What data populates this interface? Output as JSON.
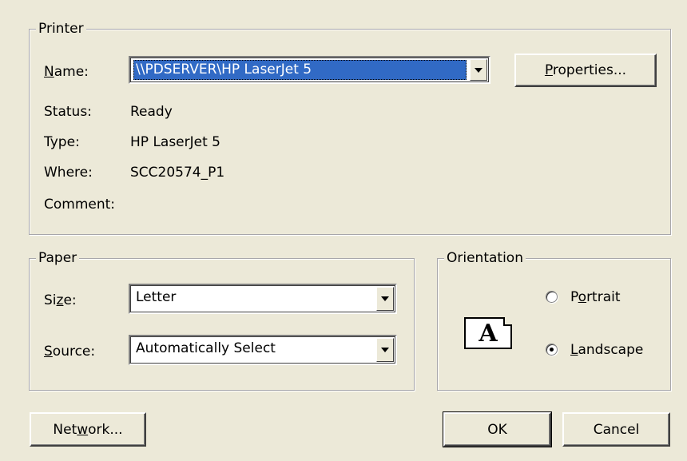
{
  "printer": {
    "title": "Printer",
    "name_label_accel": "N",
    "name_label_rest": "ame:",
    "name_value": "\\\\PDSERVER\\HP LaserJet 5",
    "properties_accel": "P",
    "properties_rest": "roperties...",
    "status_label": "Status:",
    "status_value": "Ready",
    "type_label": "Type:",
    "type_value": "HP LaserJet 5",
    "where_label": "Where:",
    "where_value": "SCC20574_P1",
    "comment_label": "Comment:",
    "comment_value": ""
  },
  "paper": {
    "title": "Paper",
    "size_label_pre": "Si",
    "size_label_accel": "z",
    "size_label_post": "e:",
    "size_value": "Letter",
    "source_label_accel": "S",
    "source_label_rest": "ource:",
    "source_value": "Automatically Select"
  },
  "orientation": {
    "title": "Orientation",
    "icon_letter": "A",
    "portrait_pre": "P",
    "portrait_accel": "o",
    "portrait_post": "rtrait",
    "landscape_accel": "L",
    "landscape_rest": "andscape",
    "selected": "Landscape"
  },
  "buttons": {
    "network_pre": "Net",
    "network_accel": "w",
    "network_post": "ork...",
    "ok": "OK",
    "cancel": "Cancel"
  }
}
